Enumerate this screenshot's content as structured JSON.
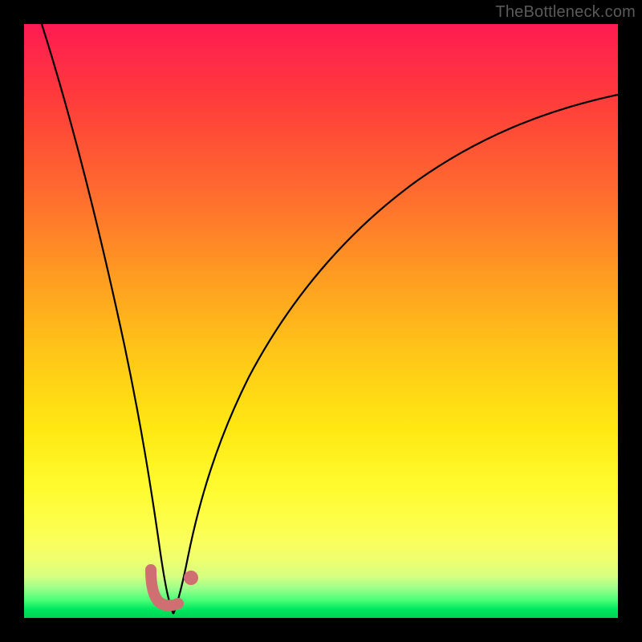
{
  "watermark": "TheBottleneck.com",
  "chart_data": {
    "type": "line",
    "title": "",
    "xlabel": "",
    "ylabel": "",
    "xlim": [
      0,
      100
    ],
    "ylim": [
      0,
      100
    ],
    "grid": false,
    "background_gradient": {
      "top": "#ff1b52",
      "mid": "#ffe812",
      "bottom": "#00d455"
    },
    "series": [
      {
        "name": "curve-left",
        "x": [
          3,
          6,
          9,
          12,
          15,
          17,
          19,
          20.5,
          22,
          23,
          24,
          25
        ],
        "values": [
          100,
          78,
          58,
          41,
          26,
          17,
          10,
          6,
          3.5,
          2,
          1.2,
          1
        ]
      },
      {
        "name": "curve-right",
        "x": [
          25,
          26.5,
          28,
          31,
          35,
          40,
          47,
          55,
          64,
          74,
          85,
          100
        ],
        "values": [
          1,
          2,
          4,
          10,
          19,
          30,
          43,
          55,
          66,
          75,
          82,
          88
        ]
      }
    ],
    "markers": [
      {
        "name": "marker-L",
        "shape": "L",
        "color": "#cf6f71",
        "x": 22.5,
        "y": 4,
        "size": 6
      },
      {
        "name": "marker-dot",
        "shape": "dot",
        "color": "#cf6f71",
        "x": 27.5,
        "y": 5,
        "size": 3
      }
    ]
  }
}
